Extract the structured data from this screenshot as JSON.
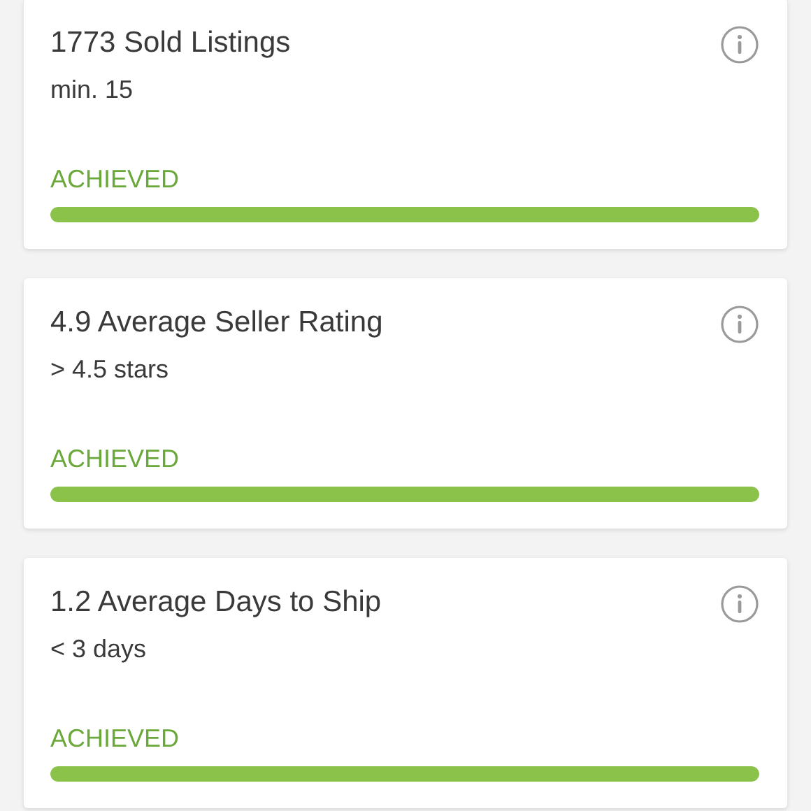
{
  "metrics": [
    {
      "title": "1773 Sold Listings",
      "requirement": "min. 15",
      "status": "ACHIEVED",
      "level": 1
    },
    {
      "title": "4.9 Average Seller Rating",
      "requirement": "> 4.5 stars",
      "status": "ACHIEVED",
      "level": 1
    },
    {
      "title": "1.2 Average Days to Ship",
      "requirement": "< 3 days",
      "status": "ACHIEVED",
      "level": 1
    }
  ]
}
